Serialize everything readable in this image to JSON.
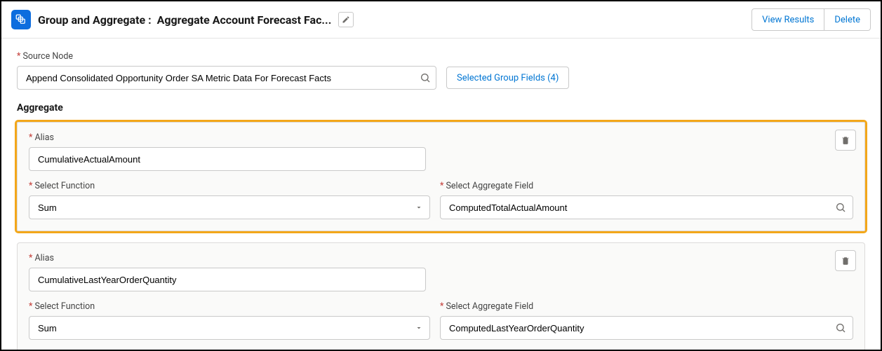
{
  "header": {
    "nodeType": "Group and Aggregate",
    "nodeName": "Aggregate Account Forecast Fac...",
    "actions": {
      "viewResults": "View Results",
      "delete": "Delete"
    }
  },
  "form": {
    "sourceNodeLabel": "Source Node",
    "sourceNodeValue": "Append Consolidated Opportunity Order SA Metric Data For Forecast Facts",
    "groupFieldsButton": "Selected Group Fields (4)",
    "aggregateLabel": "Aggregate",
    "aliasLabel": "Alias",
    "selectFunctionLabel": "Select Function",
    "selectAggregateFieldLabel": "Select Aggregate Field"
  },
  "aggregates": [
    {
      "alias": "CumulativeActualAmount",
      "function": "Sum",
      "field": "ComputedTotalActualAmount",
      "highlighted": true
    },
    {
      "alias": "CumulativeLastYearOrderQuantity",
      "function": "Sum",
      "field": "ComputedLastYearOrderQuantity",
      "highlighted": false
    }
  ]
}
